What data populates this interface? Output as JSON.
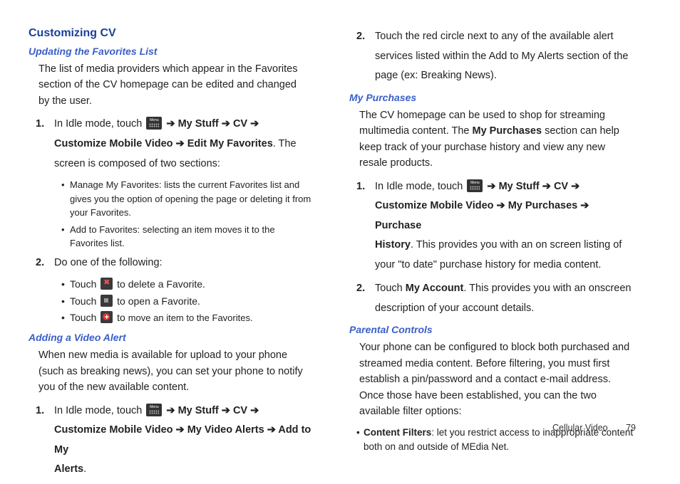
{
  "left": {
    "h2": "Customizing CV",
    "h3a": "Updating the Favorites List",
    "p1": "The list of media providers which appear in the Favorites section of the CV homepage can be edited and changed by the user.",
    "s1_num": "1.",
    "s1_a": "In Idle mode, touch ",
    "s1_b": " ➔ My Stuff ➔ CV  ➔ ",
    "s1_c": "Customize Mobile Video ➔ Edit My Favorites",
    "s1_d": ". The",
    "s1_e": "screen is composed of two sections:",
    "b1a": "Manage My Favorites: lists the current Favorites list and gives you the option of opening the page or deleting it from your Favorites.",
    "b1b": "Add to Favorites: selecting an item moves it to the Favorites list.",
    "s2_num": "2.",
    "s2_a": "Do one of the following:",
    "b2a_pre": "Touch ",
    "b2a_post": " to delete a Favorite.",
    "b2b_pre": "Touch ",
    "b2b_post": " to open a Favorite.",
    "b2c_pre": "Touch ",
    "b2c_mid": " to ",
    "b2c_post": "move an item to the Favorites.",
    "h3b": "Adding a Video Alert",
    "p2": "When new media is available for upload to your phone (such as breaking news), you can set your phone to notify you of the new available content.",
    "s3_num": "1.",
    "s3_a": "In Idle mode, touch ",
    "s3_b": " ➔ My Stuff ➔ CV  ➔ ",
    "s3_c": "Customize Mobile Video ➔ My Video Alerts ➔ Add to My",
    "s3_d": "Alerts",
    "s3_e": "."
  },
  "right": {
    "s4_num": "2.",
    "s4_a": "Touch the red circle next to any of the available alert services listed within the Add to My Alerts section of the page (ex: Breaking News).",
    "h3c": "My Purchases",
    "p3a": "The CV homepage can be used to shop for streaming multimedia content. The ",
    "p3b": "My Purchases",
    "p3c": " section can help keep track of your purchase history and view any new resale products.",
    "s5_num": "1.",
    "s5_a": "In Idle mode, touch ",
    "s5_b": " ➔ My Stuff ➔ CV  ➔ ",
    "s5_c": "Customize Mobile Video ➔ My Purchases ➔ Purchase",
    "s5_d": "History",
    "s5_e": ". This provides you with an on screen listing of your \"to date\" purchase history for media content.",
    "s6_num": "2.",
    "s6_a": "Touch ",
    "s6_b": "My Account",
    "s6_c": ". This provides you with an onscreen description of your account details.",
    "h3d": "Parental Controls",
    "p4": "Your phone can be configured to block both purchased and streamed media content. Before filtering, you must first establish a pin/password and a contact e-mail address. Once those have been established, you can the two available filter options:",
    "b3a": "Content Filters",
    "b3b": ": let you restrict access to inappropriate content both on and outside of MEdia Net."
  },
  "footer": {
    "section": "Cellular Video",
    "page": "79"
  }
}
